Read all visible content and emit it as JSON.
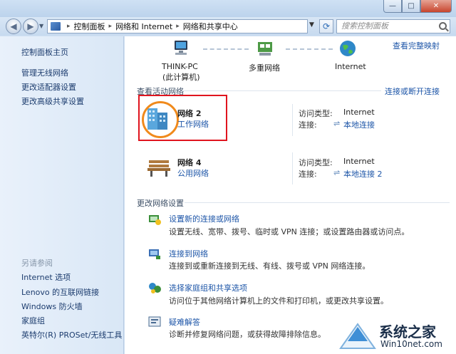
{
  "window": {
    "min": "—",
    "max": "□",
    "close": "✕"
  },
  "nav": {
    "back": "◀",
    "forward": "▶",
    "breadcrumbs": [
      "控制面板",
      "网络和 Internet",
      "网络和共享中心"
    ],
    "search_placeholder": "搜索控制面板"
  },
  "sidebar": {
    "home": "控制面板主页",
    "links": [
      "管理无线网络",
      "更改适配器设置",
      "更改高级共享设置"
    ],
    "see_also_title": "另请参阅",
    "see_also": [
      "Internet 选项",
      "Lenovo 的互联网链接",
      "Windows 防火墙",
      "家庭组",
      "英特尔(R) PROSet/无线工具"
    ]
  },
  "map": {
    "view_full_map": "查看完整映射",
    "nodes": [
      {
        "name": "THINK-PC",
        "sub": "(此计算机)"
      },
      {
        "name": "多重网络",
        "sub": ""
      },
      {
        "name": "Internet",
        "sub": ""
      }
    ]
  },
  "active_networks": {
    "title": "查看活动网络",
    "connect_link": "连接或断开连接",
    "networks": [
      {
        "name": "网络  2",
        "type": "工作网络",
        "access_label": "访问类型:",
        "access_value": "Internet",
        "conn_label": "连接:",
        "conn_value": "本地连接"
      },
      {
        "name": "网络  4",
        "type": "公用网络",
        "access_label": "访问类型:",
        "access_value": "Internet",
        "conn_label": "连接:",
        "conn_value": "本地连接 2"
      }
    ]
  },
  "change_settings": {
    "title": "更改网络设置",
    "tasks": [
      {
        "title": "设置新的连接或网络",
        "desc": "设置无线、宽带、拨号、临时或 VPN 连接；或设置路由器或访问点。"
      },
      {
        "title": "连接到网络",
        "desc": "连接到或重新连接到无线、有线、拨号或 VPN 网络连接。"
      },
      {
        "title": "选择家庭组和共享选项",
        "desc": "访问位于其他网络计算机上的文件和打印机，或更改共享设置。"
      },
      {
        "title": "疑难解答",
        "desc": "诊断并修复网络问题，或获得故障排除信息。"
      }
    ]
  },
  "watermark": {
    "brand": "系统之家",
    "url": "Win10net.com"
  },
  "colors": {
    "link": "#1e56a8",
    "highlight": "#e0141e",
    "circle": "#f08a1c"
  }
}
